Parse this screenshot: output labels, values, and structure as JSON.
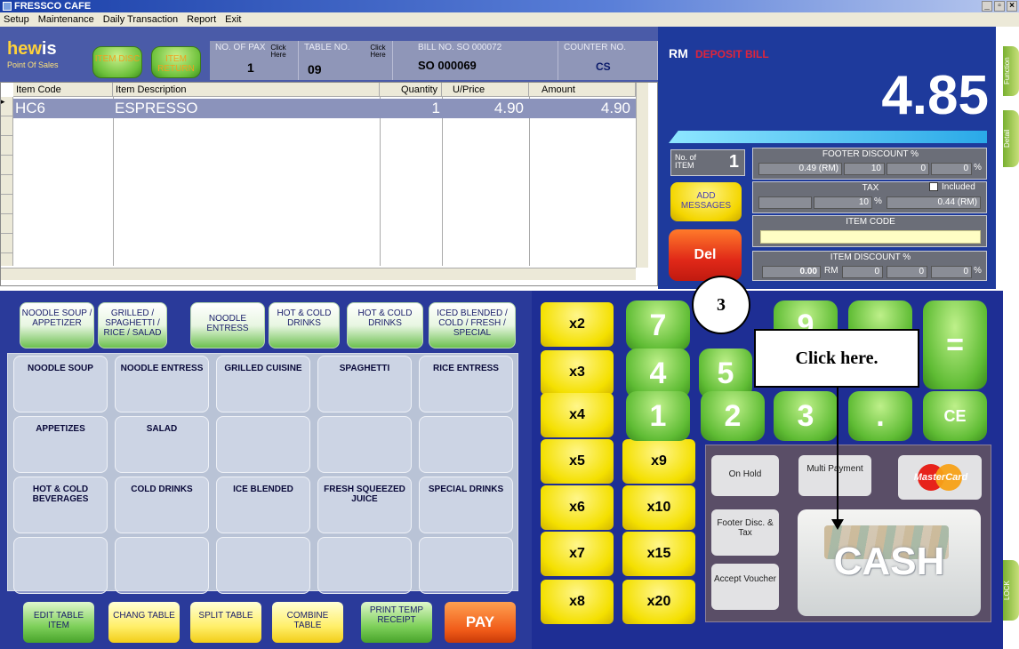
{
  "window": {
    "title": "FRESSCO CAFE",
    "controls": [
      "_",
      "▫",
      "×"
    ]
  },
  "menu": [
    "Setup",
    "Maintenance",
    "Daily Transaction",
    "Report",
    "Exit"
  ],
  "logo": {
    "brand_a": "hew",
    "brand_b": "is",
    "sub": "Point Of Sales"
  },
  "header": {
    "item_disc": "ITEM DISC",
    "item_return": "ITEM RETURN",
    "no_of_pax_label": "NO. OF PAX",
    "no_of_pax_value": "1",
    "table_no_label": "TABLE NO.",
    "table_no_value": "09",
    "click_here": "Click Here",
    "bill_no_label": "BILL NO. SO 000072",
    "bill_no_value": "SO  000069",
    "counter_no_label": "COUNTER NO.",
    "counter_no_value": "CS"
  },
  "grid": {
    "columns": [
      "Item Code",
      "Item Description",
      "Quantity",
      "U/Price",
      "Amount"
    ],
    "rows": [
      {
        "code": "HC6",
        "desc": "ESPRESSO",
        "qty": "1",
        "price": "4.90",
        "amount": "4.90"
      }
    ]
  },
  "display": {
    "currency": "RM",
    "deposit_bill": "DEPOSIT BILL",
    "total": "4.85",
    "no_of_item_label": "No. of ITEM",
    "no_of_item_value": "1",
    "footer_discount_title": "FOOTER DISCOUNT %",
    "footer_discount_rm": "0.49 (RM)",
    "footer_discount_pct": "10",
    "footer_discount_f3": "0",
    "footer_discount_f4": "0",
    "percent_sign": "%",
    "tax_title": "TAX",
    "tax_included": "Included",
    "tax_pct": "10",
    "tax_rm": "0.44 (RM)",
    "item_code_title": "ITEM CODE",
    "item_discount_title": "ITEM DISCOUNT %",
    "item_discount_rm": "0.00",
    "rm_label": "RM",
    "item_discount_f2": "0",
    "item_discount_f3": "0",
    "item_discount_f4": "0",
    "add_messages": "ADD MESSAGES",
    "del": "Del"
  },
  "side_tabs": [
    "Function",
    "Detail",
    "LOCK"
  ],
  "categories": [
    "NOODLE SOUP / APPETIZER",
    "GRILLED / SPAGHETTI / RICE / SALAD",
    "NOODLE ENTRESS",
    "HOT & COLD DRINKS",
    "HOT & COLD DRINKS",
    "ICED BLENDED / COLD / FRESH / SPECIAL"
  ],
  "items": [
    "NOODLE SOUP",
    "NOODLE ENTRESS",
    "GRILLED CUISINE",
    "SPAGHETTI",
    "RICE ENTRESS",
    "APPETIZES",
    "SALAD",
    "",
    "",
    "",
    "HOT & COLD BEVERAGES",
    "COLD DRINKS",
    "ICE BLENDED",
    "FRESH SQUEEZED JUICE",
    "SPECIAL DRINKS",
    "",
    "",
    "",
    "",
    ""
  ],
  "bottom": {
    "edit": "EDIT TABLE ITEM",
    "change": "CHANG TABLE",
    "split": "SPLIT TABLE",
    "combine": "COMBINE TABLE",
    "print": "PRINT TEMP RECEIPT",
    "pay": "PAY"
  },
  "multipliers": [
    "x2",
    "x3",
    "x4",
    "x5",
    "x6",
    "x7",
    "x8",
    "x9",
    "x10",
    "x15",
    "x20"
  ],
  "keypad": {
    "k7": "7",
    "k9": "9",
    "eq": "=",
    "k4": "4",
    "k5": "5",
    "k1": "1",
    "k2": "2",
    "k3": "3",
    "dot": ".",
    "ce": "CE"
  },
  "payment": {
    "on_hold": "On Hold",
    "multi_payment": "Multi Payment",
    "mastercard": "MasterCard",
    "footer_disc_tax": "Footer Disc. & Tax",
    "accept_voucher": "Accept Voucher",
    "cash": "CASH"
  },
  "annotation": {
    "step": "3",
    "instruction": "Click here."
  }
}
